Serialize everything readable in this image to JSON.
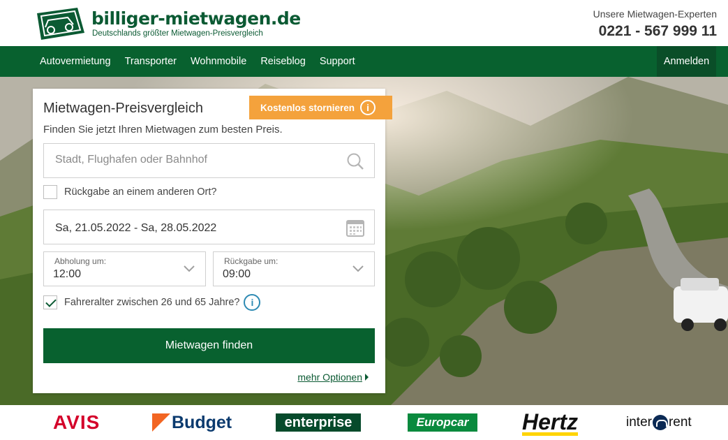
{
  "header": {
    "logo_title": "billiger-mietwagen.de",
    "logo_subtitle": "Deutschlands größter Mietwagen-Preisvergleich",
    "contact_label": "Unsere Mietwagen-Experten",
    "contact_phone": "0221 - 567 999 11"
  },
  "nav": {
    "items": [
      "Autovermietung",
      "Transporter",
      "Wohnmobile",
      "Reiseblog",
      "Support"
    ],
    "login": "Anmelden"
  },
  "search": {
    "title": "Mietwagen-Preisvergleich",
    "badge": "Kostenlos stornieren",
    "badge_icon": "info-icon",
    "subtitle": "Finden Sie jetzt Ihren Mietwagen zum besten Preis.",
    "location_placeholder": "Stadt, Flughafen oder Bahnhof",
    "return_other_label": "Rückgabe an einem anderen Ort?",
    "return_other_checked": false,
    "dates": "Sa, 21.05.2022 - Sa, 28.05.2022",
    "pickup_label": "Abholung um:",
    "pickup_time": "12:00",
    "return_label": "Rückgabe um:",
    "return_time": "09:00",
    "age_label": "Fahreralter zwischen 26 und 65 Jahre?",
    "age_checked": true,
    "submit": "Mietwagen finden",
    "more_options": "mehr Optionen"
  },
  "brands": {
    "avis": "AVIS",
    "budget": "Budget",
    "enterprise": "enterprise",
    "europcar": "Europcar",
    "hertz": "Hertz",
    "interrent_a": "inter",
    "interrent_b": "rent"
  },
  "colors": {
    "brand_green": "#08612f",
    "badge_orange": "#f4a23c",
    "info_blue": "#2d8ab3"
  }
}
